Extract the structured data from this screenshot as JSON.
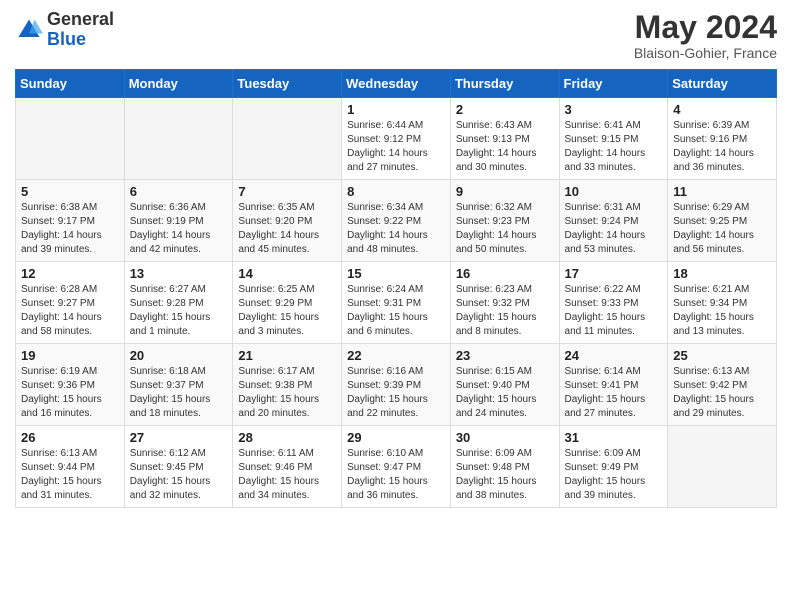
{
  "header": {
    "logo_general": "General",
    "logo_blue": "Blue",
    "month_title": "May 2024",
    "location": "Blaison-Gohier, France"
  },
  "weekdays": [
    "Sunday",
    "Monday",
    "Tuesday",
    "Wednesday",
    "Thursday",
    "Friday",
    "Saturday"
  ],
  "weeks": [
    [
      {
        "day": "",
        "info": ""
      },
      {
        "day": "",
        "info": ""
      },
      {
        "day": "",
        "info": ""
      },
      {
        "day": "1",
        "info": "Sunrise: 6:44 AM\nSunset: 9:12 PM\nDaylight: 14 hours\nand 27 minutes."
      },
      {
        "day": "2",
        "info": "Sunrise: 6:43 AM\nSunset: 9:13 PM\nDaylight: 14 hours\nand 30 minutes."
      },
      {
        "day": "3",
        "info": "Sunrise: 6:41 AM\nSunset: 9:15 PM\nDaylight: 14 hours\nand 33 minutes."
      },
      {
        "day": "4",
        "info": "Sunrise: 6:39 AM\nSunset: 9:16 PM\nDaylight: 14 hours\nand 36 minutes."
      }
    ],
    [
      {
        "day": "5",
        "info": "Sunrise: 6:38 AM\nSunset: 9:17 PM\nDaylight: 14 hours\nand 39 minutes."
      },
      {
        "day": "6",
        "info": "Sunrise: 6:36 AM\nSunset: 9:19 PM\nDaylight: 14 hours\nand 42 minutes."
      },
      {
        "day": "7",
        "info": "Sunrise: 6:35 AM\nSunset: 9:20 PM\nDaylight: 14 hours\nand 45 minutes."
      },
      {
        "day": "8",
        "info": "Sunrise: 6:34 AM\nSunset: 9:22 PM\nDaylight: 14 hours\nand 48 minutes."
      },
      {
        "day": "9",
        "info": "Sunrise: 6:32 AM\nSunset: 9:23 PM\nDaylight: 14 hours\nand 50 minutes."
      },
      {
        "day": "10",
        "info": "Sunrise: 6:31 AM\nSunset: 9:24 PM\nDaylight: 14 hours\nand 53 minutes."
      },
      {
        "day": "11",
        "info": "Sunrise: 6:29 AM\nSunset: 9:25 PM\nDaylight: 14 hours\nand 56 minutes."
      }
    ],
    [
      {
        "day": "12",
        "info": "Sunrise: 6:28 AM\nSunset: 9:27 PM\nDaylight: 14 hours\nand 58 minutes."
      },
      {
        "day": "13",
        "info": "Sunrise: 6:27 AM\nSunset: 9:28 PM\nDaylight: 15 hours\nand 1 minute."
      },
      {
        "day": "14",
        "info": "Sunrise: 6:25 AM\nSunset: 9:29 PM\nDaylight: 15 hours\nand 3 minutes."
      },
      {
        "day": "15",
        "info": "Sunrise: 6:24 AM\nSunset: 9:31 PM\nDaylight: 15 hours\nand 6 minutes."
      },
      {
        "day": "16",
        "info": "Sunrise: 6:23 AM\nSunset: 9:32 PM\nDaylight: 15 hours\nand 8 minutes."
      },
      {
        "day": "17",
        "info": "Sunrise: 6:22 AM\nSunset: 9:33 PM\nDaylight: 15 hours\nand 11 minutes."
      },
      {
        "day": "18",
        "info": "Sunrise: 6:21 AM\nSunset: 9:34 PM\nDaylight: 15 hours\nand 13 minutes."
      }
    ],
    [
      {
        "day": "19",
        "info": "Sunrise: 6:19 AM\nSunset: 9:36 PM\nDaylight: 15 hours\nand 16 minutes."
      },
      {
        "day": "20",
        "info": "Sunrise: 6:18 AM\nSunset: 9:37 PM\nDaylight: 15 hours\nand 18 minutes."
      },
      {
        "day": "21",
        "info": "Sunrise: 6:17 AM\nSunset: 9:38 PM\nDaylight: 15 hours\nand 20 minutes."
      },
      {
        "day": "22",
        "info": "Sunrise: 6:16 AM\nSunset: 9:39 PM\nDaylight: 15 hours\nand 22 minutes."
      },
      {
        "day": "23",
        "info": "Sunrise: 6:15 AM\nSunset: 9:40 PM\nDaylight: 15 hours\nand 24 minutes."
      },
      {
        "day": "24",
        "info": "Sunrise: 6:14 AM\nSunset: 9:41 PM\nDaylight: 15 hours\nand 27 minutes."
      },
      {
        "day": "25",
        "info": "Sunrise: 6:13 AM\nSunset: 9:42 PM\nDaylight: 15 hours\nand 29 minutes."
      }
    ],
    [
      {
        "day": "26",
        "info": "Sunrise: 6:13 AM\nSunset: 9:44 PM\nDaylight: 15 hours\nand 31 minutes."
      },
      {
        "day": "27",
        "info": "Sunrise: 6:12 AM\nSunset: 9:45 PM\nDaylight: 15 hours\nand 32 minutes."
      },
      {
        "day": "28",
        "info": "Sunrise: 6:11 AM\nSunset: 9:46 PM\nDaylight: 15 hours\nand 34 minutes."
      },
      {
        "day": "29",
        "info": "Sunrise: 6:10 AM\nSunset: 9:47 PM\nDaylight: 15 hours\nand 36 minutes."
      },
      {
        "day": "30",
        "info": "Sunrise: 6:09 AM\nSunset: 9:48 PM\nDaylight: 15 hours\nand 38 minutes."
      },
      {
        "day": "31",
        "info": "Sunrise: 6:09 AM\nSunset: 9:49 PM\nDaylight: 15 hours\nand 39 minutes."
      },
      {
        "day": "",
        "info": ""
      }
    ]
  ]
}
